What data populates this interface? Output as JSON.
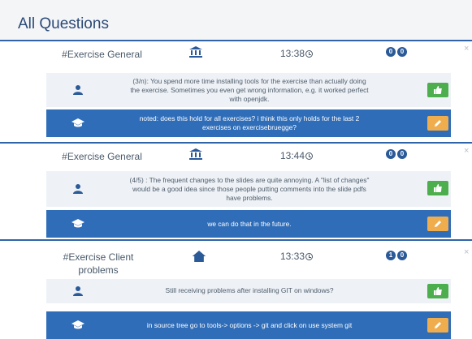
{
  "page": {
    "title": "All Questions"
  },
  "questions": [
    {
      "category": "#Exercise General",
      "category_icon": "bank-icon",
      "time": "13:38",
      "badges": [
        "0",
        "0"
      ],
      "close": "×",
      "question": "(3/n): You spend more time installing tools for the exercise than actually doing the exercise. Sometimes you even get wrong information, e.g. it worked perfect with openjdk.",
      "answer": "noted: does this hold for all exercises? i think this only holds for the last 2 exercises on exercisebruegge?"
    },
    {
      "category": "#Exercise General",
      "category_icon": "bank-icon",
      "time": "13:44",
      "badges": [
        "0",
        "0"
      ],
      "close": "×",
      "question": "(4/5) : The frequent changes to the slides are quite annoying. A \"list of changes\" would be a good idea since those people putting comments into the slide pdfs have problems.",
      "answer": "we can do that in the future."
    },
    {
      "category": "#Exercise Client problems",
      "category_icon": "home-icon",
      "time": "13:33",
      "badges": [
        "1",
        "0"
      ],
      "close": "×",
      "question": "Still receiving problems after installing GIT on windows?",
      "answer": "in source tree go to tools-> options -> git and click on use system git"
    }
  ],
  "colors": {
    "primary": "#2f6db8",
    "like": "#4cae4c",
    "edit": "#f0ad4e",
    "badge": "#2b5a98"
  }
}
